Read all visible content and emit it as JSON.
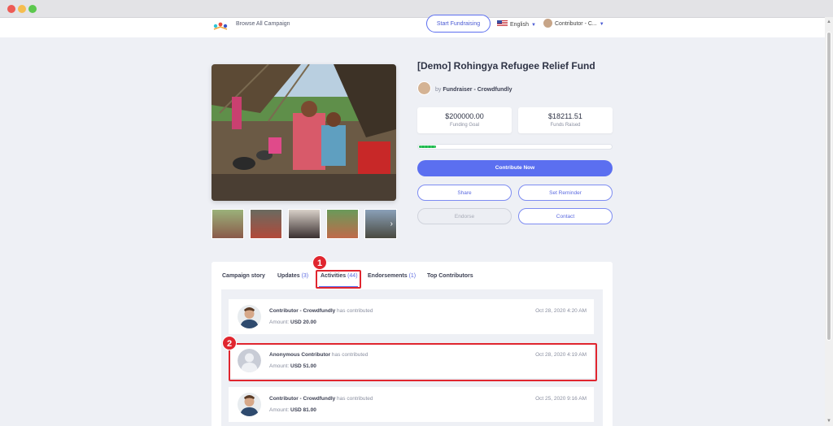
{
  "navbar": {
    "browse_label": "Browse All Campaign",
    "start_button": "Start Fundraising",
    "language": "English",
    "user_label": "Contributor - C..."
  },
  "campaign": {
    "title": "[Demo] Rohingya Refugee Relief Fund",
    "by_prefix": "by",
    "fundraiser": "Fundraiser - Crowdfundly",
    "funding_goal_value": "$200000.00",
    "funding_goal_label": "Funding Goal",
    "funds_raised_value": "$18211.51",
    "funds_raised_label": "Funds Raised",
    "progress_fraction": 0.09
  },
  "actions": {
    "contribute": "Contribute Now",
    "share": "Share",
    "set_reminder": "Set Reminder",
    "endorse": "Endorse",
    "contact": "Contact"
  },
  "tabs": [
    {
      "label": "Campaign story",
      "count": ""
    },
    {
      "label": "Updates",
      "count": "(3)"
    },
    {
      "label": "Activities",
      "count": "(44)"
    },
    {
      "label": "Endorsements",
      "count": "(1)"
    },
    {
      "label": "Top Contributors",
      "count": ""
    }
  ],
  "activities": [
    {
      "name": "Contributor - Crowdfundly",
      "action": "has contributed",
      "amount_label": "Amount:",
      "amount": "USD 20.00",
      "date": "Oct 28, 2020 4:20 AM"
    },
    {
      "name": "Anonymous Contributor",
      "action": "has contributed",
      "amount_label": "Amount:",
      "amount": "USD 51.00",
      "date": "Oct 28, 2020 4:19 AM"
    },
    {
      "name": "Contributor - Crowdfundly",
      "action": "has contributed",
      "amount_label": "Amount:",
      "amount": "USD 81.00",
      "date": "Oct 25, 2020 9:16 AM"
    }
  ],
  "annotations": {
    "marker_1": "1",
    "marker_2": "2"
  },
  "colors": {
    "accent": "#5b6ff0",
    "highlight": "#e0262f",
    "progress": "#1fb24f"
  }
}
